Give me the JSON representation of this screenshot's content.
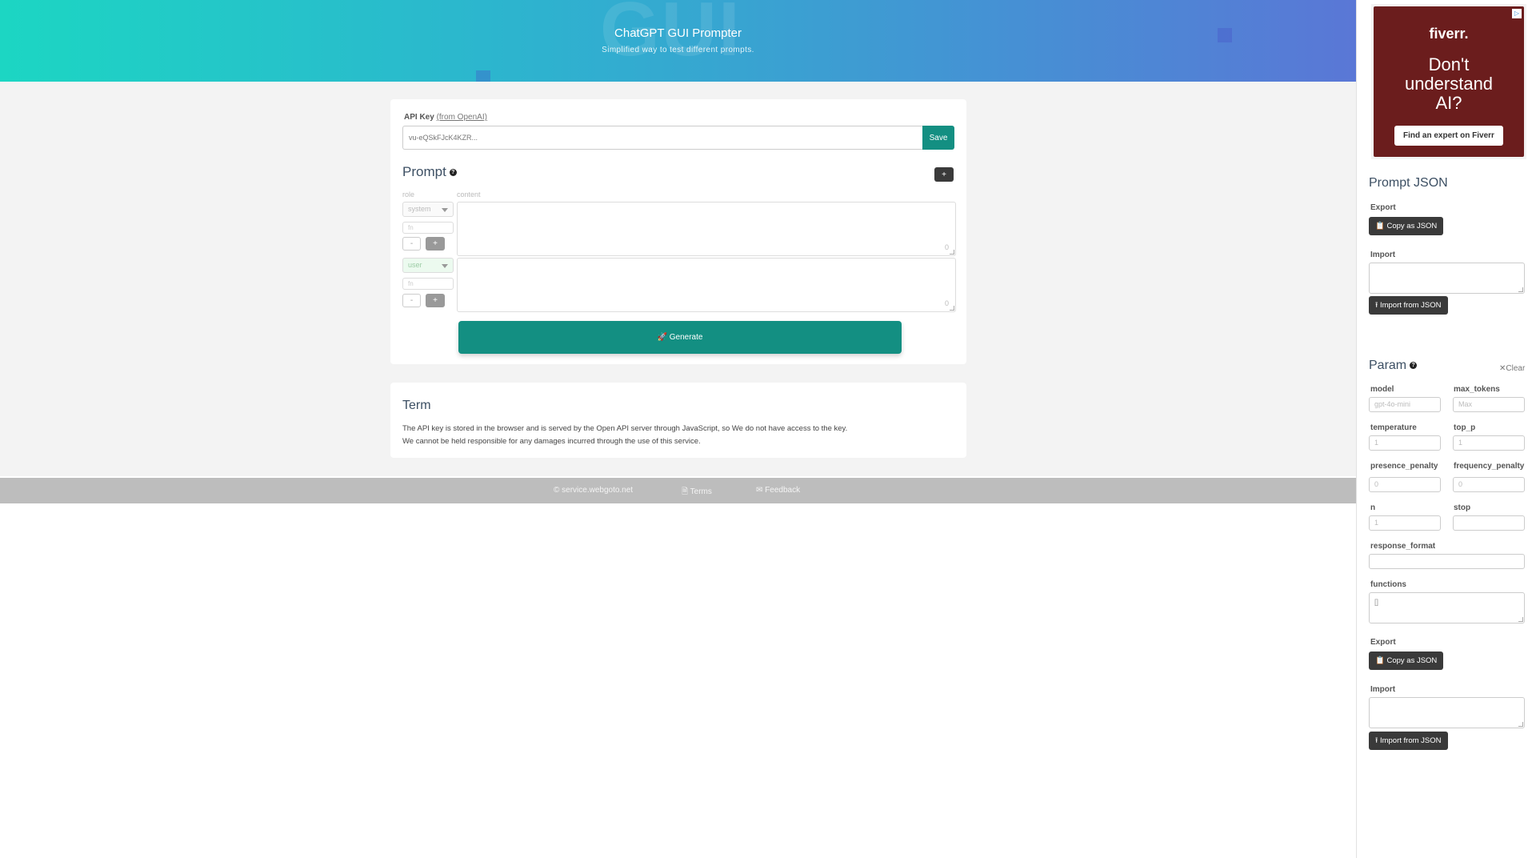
{
  "hero": {
    "watermark": "GUI",
    "title": "ChatGPT GUI Prompter",
    "subtitle": "Simplified way to test different prompts."
  },
  "api_key": {
    "label": "API Key",
    "link_text": "(from OpenAI)",
    "placeholder": "vu-eQSkFJcK4KZR...",
    "save_label": "Save"
  },
  "prompt": {
    "heading": "Prompt",
    "help_icon": "?",
    "add_label": "+",
    "role_col": "role",
    "content_col": "content",
    "messages": [
      {
        "role": "system",
        "name_placeholder": "fn",
        "minus": "-",
        "plus": "+",
        "count": "0"
      },
      {
        "role": "user",
        "name_placeholder": "fn",
        "minus": "-",
        "plus": "+",
        "count": "0"
      }
    ],
    "generate_label": "🚀 Generate"
  },
  "term": {
    "heading": "Term",
    "line1": "The API key is stored in the browser and is served by the Open API server through JavaScript, so We do not have access to the key.",
    "line2": "We cannot be held responsible for any damages incurred through the use of this service."
  },
  "footer": {
    "copyright": "© service.webgoto.net",
    "terms": "🗎 Terms",
    "feedback": "✉ Feedback"
  },
  "ad": {
    "adchoices": "▷",
    "brand": "fiverr.",
    "line1": "Don't",
    "line2": "understand",
    "line3": "AI?",
    "cta": "Find an expert on Fiverr"
  },
  "prompt_json": {
    "heading": "Prompt JSON",
    "export_label": "Export",
    "copy_button": "📋 Copy as JSON",
    "import_label": "Import",
    "import_button": "⭱ Import from JSON"
  },
  "param": {
    "heading": "Param",
    "clear": "✕Clear",
    "model_label": "model",
    "model_placeholder": "gpt-4o-mini",
    "max_tokens_label": "max_tokens",
    "max_tokens_placeholder": "Max",
    "temperature_label": "temperature",
    "temperature_placeholder": "1",
    "top_p_label": "top_p",
    "top_p_placeholder": "1",
    "presence_penalty_label": "presence_penalty",
    "presence_penalty_placeholder": "0",
    "frequency_penalty_label": "frequency_penalty",
    "frequency_penalty_placeholder": "0",
    "n_label": "n",
    "n_placeholder": "1",
    "stop_label": "stop",
    "stop_placeholder": "",
    "response_format_label": "response_format",
    "functions_label": "functions",
    "functions_value": "[]",
    "export_label": "Export",
    "copy_button": "📋 Copy as JSON",
    "import_label": "Import",
    "import_button": "⭱ Import from JSON"
  },
  "colors": {
    "accent": "#138f82",
    "hero_start": "#1cd6c3",
    "hero_end": "#5a77d6",
    "footer": "#bdbdbd",
    "dark_button": "#3a3a3a"
  }
}
